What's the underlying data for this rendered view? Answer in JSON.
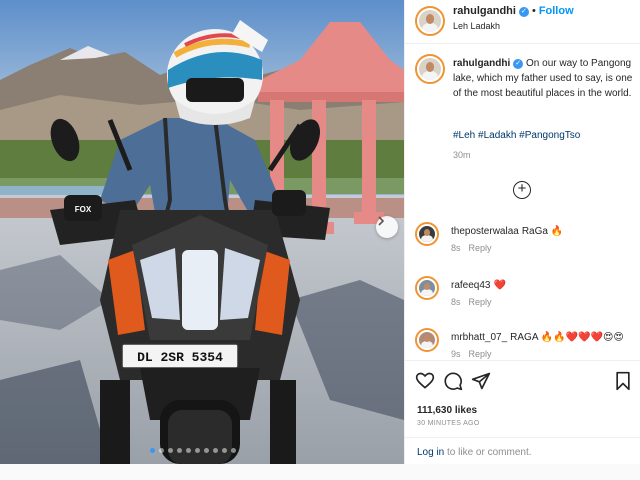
{
  "post": {
    "username": "rahulgandhi",
    "follow_label": "Follow",
    "location": "Leh Ladakh",
    "caption": "On our way to Pangong lake, which my father used to say, is one of the most beautiful places in the world.",
    "hashtags": "#Leh #Ladakh #PangongTso",
    "time": "30m",
    "likes": "111,630 likes",
    "posted_ago": "30 MINUTES AGO",
    "login_link": "Log in",
    "login_rest": "to like or comment."
  },
  "photo": {
    "license_plate": "DL 2SR 5354",
    "glove_text": "FOX",
    "carousel_dots": 10,
    "active_dot": 0
  },
  "comments": [
    {
      "user": "theposterwalaa",
      "text": "RaGa 🔥",
      "time": "8s",
      "reply": "Reply",
      "avatar_color": "#3b3b3b"
    },
    {
      "user": "rafeeq43",
      "text": "❤️",
      "time": "8s",
      "reply": "Reply",
      "avatar_color": "#7a8fa0"
    },
    {
      "user": "mrbhatt_07_",
      "text": "RAGA 🔥🔥❤️❤️❤️😍😍",
      "time": "9s",
      "reply": "Reply",
      "avatar_color": "#b08a7a"
    }
  ],
  "icons": {
    "like": "heart-icon",
    "comment": "comment-icon",
    "share": "paper-plane-icon",
    "save": "bookmark-icon",
    "load_more": "plus-circle-icon",
    "next": "chevron-right-icon",
    "verified": "verified-badge-icon"
  },
  "colors": {
    "link_blue": "#0095f6",
    "hashtag": "#00376b",
    "secondary_text": "#8e8e8e",
    "avatar_ring": "#f09433"
  }
}
